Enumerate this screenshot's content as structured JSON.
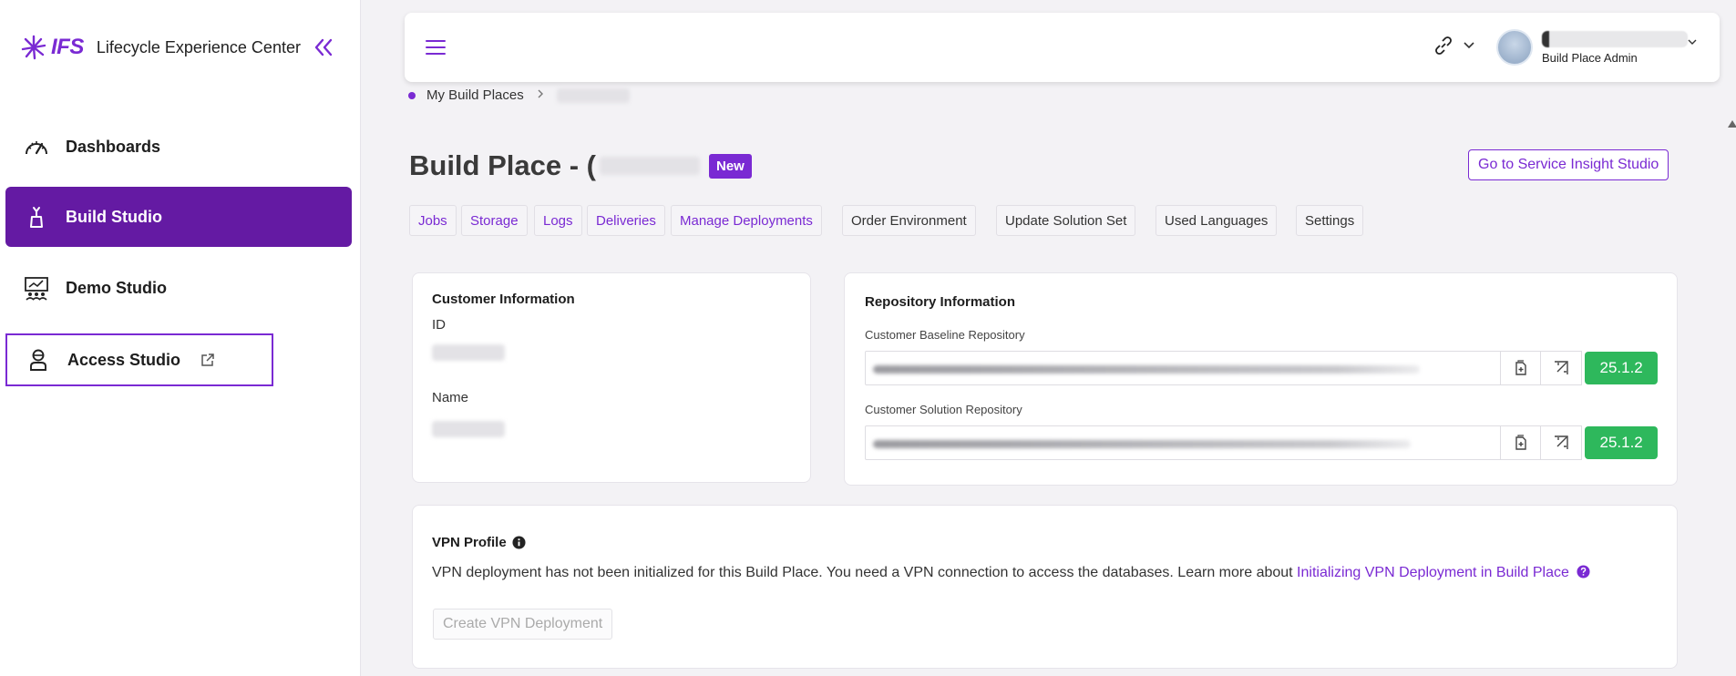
{
  "app": {
    "logo_text": "IFS",
    "name": "Lifecycle Experience Center"
  },
  "sidebar": {
    "items": [
      {
        "label": "Dashboards",
        "icon": "gauge-icon"
      },
      {
        "label": "Build Studio",
        "icon": "build-icon",
        "active": true
      },
      {
        "label": "Demo Studio",
        "icon": "presentation-icon"
      },
      {
        "label": "Access Studio",
        "icon": "user-shield-icon",
        "external": true
      }
    ]
  },
  "header": {
    "user_role": "Build Place Admin"
  },
  "breadcrumb": {
    "root": "My Build Places"
  },
  "page": {
    "title": "Build Place - (",
    "badge": "New",
    "service_button": "Go to Service Insight Studio"
  },
  "tabs": [
    {
      "label": "Jobs",
      "style": "link"
    },
    {
      "label": "Storage",
      "style": "link"
    },
    {
      "label": "Logs",
      "style": "link"
    },
    {
      "label": "Deliveries",
      "style": "link"
    },
    {
      "label": "Manage Deployments",
      "style": "link"
    },
    {
      "label": "Order Environment",
      "style": "plain"
    },
    {
      "label": "Update Solution Set",
      "style": "plain"
    },
    {
      "label": "Used Languages",
      "style": "plain"
    },
    {
      "label": "Settings",
      "style": "plain"
    }
  ],
  "customer_info": {
    "title": "Customer Information",
    "id_label": "ID",
    "name_label": "Name"
  },
  "repository_info": {
    "title": "Repository Information",
    "baseline_label": "Customer Baseline Repository",
    "baseline_version": "25.1.2",
    "solution_label": "Customer Solution Repository",
    "solution_version": "25.1.2"
  },
  "vpn": {
    "title": "VPN Profile",
    "text": "VPN deployment has not been initialized for this Build Place. You need a VPN connection to access the databases. Learn more about ",
    "link": "Initializing VPN Deployment in Build Place",
    "button": "Create VPN Deployment"
  },
  "colors": {
    "accent": "#7a2ad3",
    "active_nav": "#641aa3",
    "version_green": "#2eb85c",
    "background": "#f3f2f5"
  }
}
